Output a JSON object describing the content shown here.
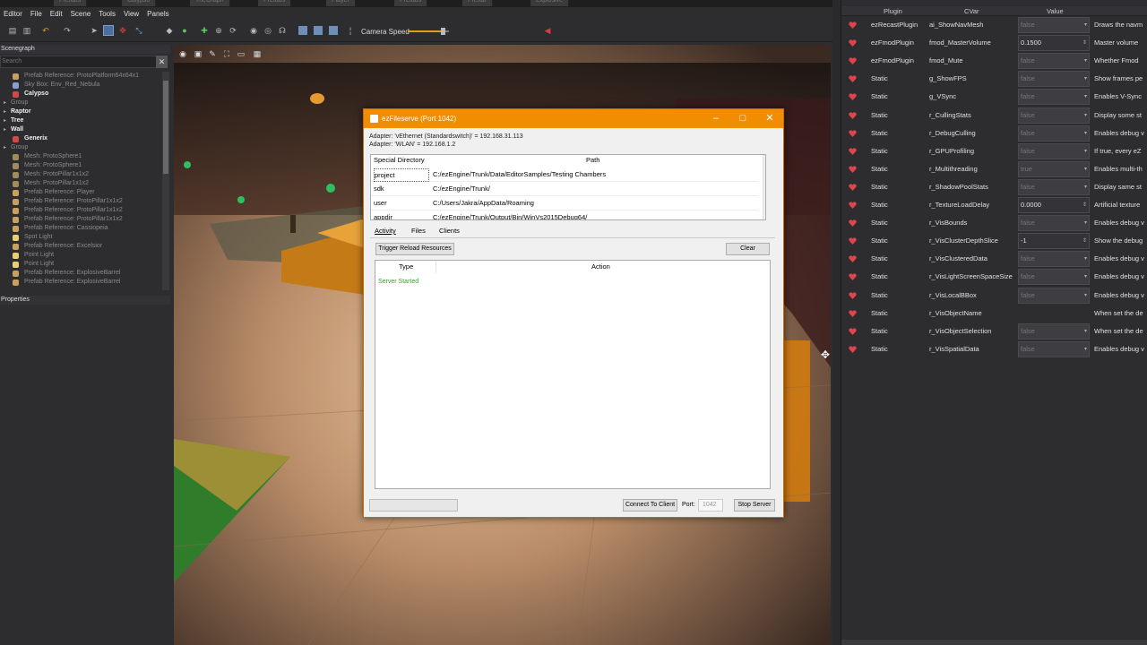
{
  "doc_tabs": [
    "Prefabs",
    "Calypso",
    "TheGraph",
    "Prefabs",
    "Player",
    "Prefabs",
    "Prefab",
    "Explosive"
  ],
  "menu": {
    "items": [
      "Editor",
      "File",
      "Edit",
      "Scene",
      "Tools",
      "View",
      "Panels"
    ]
  },
  "toolbar": {
    "camera_speed_label": "Camera Speed",
    "camera_speed_value": 0.85
  },
  "scenegraph": {
    "title": "Scenegraph",
    "search_placeholder": "Search",
    "clear_label": "✕",
    "items": [
      {
        "label": "Prefab Reference: ProtoPlatform64x64x1",
        "icon": "prefab-icon",
        "style": "dim"
      },
      {
        "label": "Sky Box: Env_Red_Nebula",
        "icon": "skybox-icon",
        "style": "dim"
      },
      {
        "label": "Calypso",
        "icon": "speaker-icon",
        "style": "bold"
      },
      {
        "label": "Group",
        "icon": "",
        "style": "dim"
      },
      {
        "label": "Raptor",
        "icon": "",
        "style": "bold"
      },
      {
        "label": "Tree",
        "icon": "",
        "style": "bold"
      },
      {
        "label": "Wall",
        "icon": "",
        "style": "bold"
      },
      {
        "label": "Generix",
        "icon": "speaker-icon",
        "style": "bold"
      },
      {
        "label": "Group",
        "icon": "",
        "style": "dim"
      },
      {
        "label": "Mesh: ProtoSphere1",
        "icon": "mesh-icon",
        "style": "dim"
      },
      {
        "label": "Mesh: ProtoSphere1",
        "icon": "mesh-icon",
        "style": "dim"
      },
      {
        "label": "Mesh: ProtoPillar1x1x2",
        "icon": "mesh-icon",
        "style": "dim"
      },
      {
        "label": "Mesh: ProtoPillar1x1x2",
        "icon": "mesh-icon",
        "style": "dim"
      },
      {
        "label": "Prefab Reference: Player",
        "icon": "prefab-icon",
        "style": "dim"
      },
      {
        "label": "Prefab Reference: ProtoPillar1x1x2",
        "icon": "prefab-icon",
        "style": "dim"
      },
      {
        "label": "Prefab Reference: ProtoPillar1x1x2",
        "icon": "prefab-icon",
        "style": "dim"
      },
      {
        "label": "Prefab Reference: ProtoPillar1x1x2",
        "icon": "prefab-icon",
        "style": "dim"
      },
      {
        "label": "Prefab Reference: Cassiopeia",
        "icon": "prefab-icon",
        "style": "dim"
      },
      {
        "label": "Spot Light",
        "icon": "light-icon",
        "style": "dim"
      },
      {
        "label": "Prefab Reference: Excelsior",
        "icon": "prefab-icon",
        "style": "dim"
      },
      {
        "label": "Point Light",
        "icon": "light-icon",
        "style": "dim"
      },
      {
        "label": "Point Light",
        "icon": "light-icon",
        "style": "dim"
      },
      {
        "label": "Prefab Reference: ExplosiveBarrel",
        "icon": "prefab-icon",
        "style": "dim"
      },
      {
        "label": "Prefab Reference: ExplosiveBarrel",
        "icon": "prefab-icon",
        "style": "dim"
      }
    ]
  },
  "properties": {
    "title": "Properties"
  },
  "dialog": {
    "title": "ezFileserve (Port 1042)",
    "adapter1": "Adapter: 'vEthernet (Standardswitch)' = 192.168.31.113",
    "adapter2": "Adapter: 'WLAN' = 192.168.1.2",
    "dir_headers": {
      "special": "Special Directory",
      "path": "Path"
    },
    "dirs": [
      {
        "name": "project",
        "path": "C:/ezEngine/Trunk/Data/EditorSamples/Testing Chambers"
      },
      {
        "name": "sdk",
        "path": "C:/ezEngine/Trunk/"
      },
      {
        "name": "user",
        "path": "C:/Users/Jakra/AppData/Roaming"
      },
      {
        "name": "appdir",
        "path": "C:/ezEngine/Trunk/Output/Bin/WinVs2015Debug64/"
      }
    ],
    "tabs": [
      "Activity",
      "Files",
      "Clients"
    ],
    "trigger_reload": "Trigger Reload Resources",
    "clear": "Clear",
    "activity_headers": {
      "type": "Type",
      "action": "Action"
    },
    "activity_msg": "Server Started",
    "connect": "Connect To Client",
    "port_label": "Port:",
    "port_value": "1042",
    "stop": "Stop Server"
  },
  "cvars": {
    "headers": {
      "plugin": "Plugin",
      "cvar": "CVar",
      "value": "Value"
    },
    "rows": [
      {
        "plugin": "ezRecastPlugin",
        "cvar": "ai_ShowNavMesh",
        "value": "false",
        "kind": "dd",
        "desc": "Draws the navm"
      },
      {
        "plugin": "ezFmodPlugin",
        "cvar": "fmod_MasterVolume",
        "value": "0.1500",
        "kind": "num",
        "desc": "Master volume"
      },
      {
        "plugin": "ezFmodPlugin",
        "cvar": "fmod_Mute",
        "value": "false",
        "kind": "dd",
        "desc": "Whether Fmod"
      },
      {
        "plugin": "Static",
        "cvar": "g_ShowFPS",
        "value": "false",
        "kind": "dd",
        "desc": "Show frames pe"
      },
      {
        "plugin": "Static",
        "cvar": "g_VSync",
        "value": "false",
        "kind": "dd",
        "desc": "Enables V-Sync"
      },
      {
        "plugin": "Static",
        "cvar": "r_CullingStats",
        "value": "false",
        "kind": "dd",
        "desc": "Display some st"
      },
      {
        "plugin": "Static",
        "cvar": "r_DebugCulling",
        "value": "false",
        "kind": "dd",
        "desc": "Enables debug v"
      },
      {
        "plugin": "Static",
        "cvar": "r_GPUProfiling",
        "value": "false",
        "kind": "dd",
        "desc": "If true, every eZ"
      },
      {
        "plugin": "Static",
        "cvar": "r_Multithreading",
        "value": "true",
        "kind": "dd",
        "desc": "Enables multi-th"
      },
      {
        "plugin": "Static",
        "cvar": "r_ShadowPoolStats",
        "value": "false",
        "kind": "dd",
        "desc": "Display same st"
      },
      {
        "plugin": "Static",
        "cvar": "r_TextureLoadDelay",
        "value": "0.0000",
        "kind": "num",
        "desc": "Artificial texture"
      },
      {
        "plugin": "Static",
        "cvar": "r_VisBounds",
        "value": "false",
        "kind": "dd",
        "desc": "Enables debug v"
      },
      {
        "plugin": "Static",
        "cvar": "r_VisClusterDepthSlice",
        "value": "-1",
        "kind": "num",
        "desc": "Show the debug"
      },
      {
        "plugin": "Static",
        "cvar": "r_VisClusteredData",
        "value": "false",
        "kind": "dd",
        "desc": "Enables debug v"
      },
      {
        "plugin": "Static",
        "cvar": "r_VisLightScreenSpaceSize",
        "value": "false",
        "kind": "dd",
        "desc": "Enables debug v"
      },
      {
        "plugin": "Static",
        "cvar": "r_VisLocalBBox",
        "value": "false",
        "kind": "dd",
        "desc": "Enables debug v"
      },
      {
        "plugin": "Static",
        "cvar": "r_VisObjectName",
        "value": "",
        "kind": "none",
        "desc": "When set the de"
      },
      {
        "plugin": "Static",
        "cvar": "r_VisObjectSelection",
        "value": "false",
        "kind": "dd",
        "desc": "When set the de"
      },
      {
        "plugin": "Static",
        "cvar": "r_VisSpatialData",
        "value": "false",
        "kind": "dd",
        "desc": "Enables debug v"
      }
    ]
  },
  "colors": {
    "accent": "#f28c00",
    "heart": "#e0444c",
    "green_text": "#2aa52a"
  }
}
